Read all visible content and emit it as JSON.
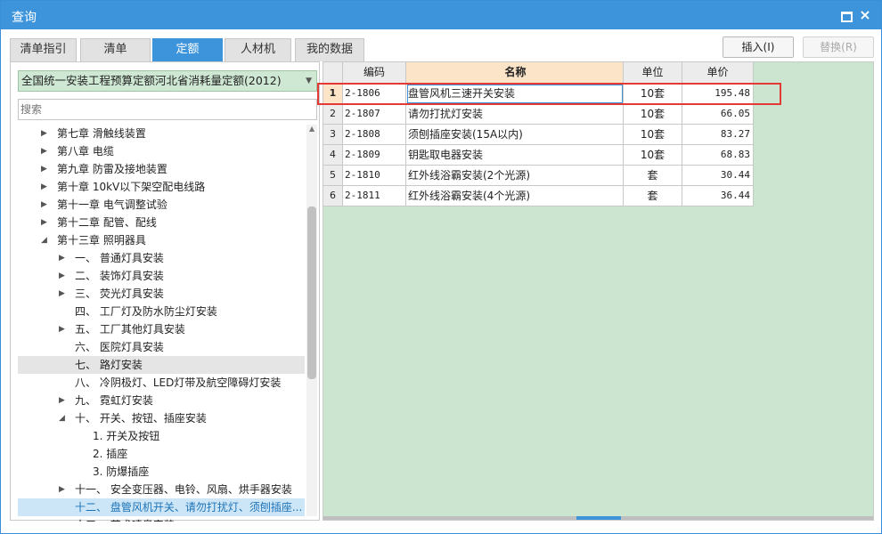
{
  "window": {
    "title": "查询"
  },
  "tabs": [
    "清单指引",
    "清单",
    "定额",
    "人材机",
    "我的数据"
  ],
  "active_tab": "定额",
  "buttons": {
    "insert": "插入(I)",
    "replace": "替换(R)"
  },
  "left": {
    "dropdown_value": "全国统一安装工程预算定额河北省消耗量定额(2012)",
    "search_placeholder": "搜索",
    "tree": [
      {
        "label": "第七章 滑触线装置",
        "level": 0,
        "arrow": "collapsed"
      },
      {
        "label": "第八章 电缆",
        "level": 0,
        "arrow": "collapsed"
      },
      {
        "label": "第九章 防雷及接地装置",
        "level": 0,
        "arrow": "collapsed"
      },
      {
        "label": "第十章 10kV以下架空配电线路",
        "level": 0,
        "arrow": "collapsed"
      },
      {
        "label": "第十一章 电气调整试验",
        "level": 0,
        "arrow": "collapsed"
      },
      {
        "label": "第十二章 配管、配线",
        "level": 0,
        "arrow": "collapsed"
      },
      {
        "label": "第十三章 照明器具",
        "level": 0,
        "arrow": "expanded"
      },
      {
        "label": "一、 普通灯具安装",
        "level": 1,
        "arrow": "collapsed"
      },
      {
        "label": "二、 装饰灯具安装",
        "level": 1,
        "arrow": "collapsed"
      },
      {
        "label": "三、 荧光灯具安装",
        "level": 1,
        "arrow": "collapsed"
      },
      {
        "label": "四、 工厂灯及防水防尘灯安装",
        "level": 1,
        "arrow": "none"
      },
      {
        "label": "五、 工厂其他灯具安装",
        "level": 1,
        "arrow": "collapsed"
      },
      {
        "label": "六、 医院灯具安装",
        "level": 1,
        "arrow": "none"
      },
      {
        "label": "七、 路灯安装",
        "level": 1,
        "arrow": "none",
        "state": "hover"
      },
      {
        "label": "八、 冷阴极灯、LED灯带及航空障碍灯安装",
        "level": 1,
        "arrow": "none"
      },
      {
        "label": "九、 霓虹灯安装",
        "level": 1,
        "arrow": "collapsed"
      },
      {
        "label": "十、 开关、按钮、插座安装",
        "level": 1,
        "arrow": "expanded"
      },
      {
        "label": "1. 开关及按钮",
        "level": 2,
        "arrow": "none"
      },
      {
        "label": "2. 插座",
        "level": 2,
        "arrow": "none"
      },
      {
        "label": "3. 防爆插座",
        "level": 2,
        "arrow": "none"
      },
      {
        "label": "十一、 安全变压器、电铃、风扇、烘手器安装",
        "level": 1,
        "arrow": "collapsed"
      },
      {
        "label": "十二、 盘管风机开关、请勿打扰灯、须刨插座...",
        "level": 1,
        "arrow": "none",
        "state": "selected"
      },
      {
        "label": "十三、 艺术喷泉安装",
        "level": 1,
        "arrow": "collapsed"
      }
    ]
  },
  "table": {
    "columns": [
      "编码",
      "名称",
      "单位",
      "单价"
    ],
    "rows": [
      {
        "no": "1",
        "code": "2-1806",
        "name": "盘管风机三速开关安装",
        "unit": "10套",
        "price": "195.48"
      },
      {
        "no": "2",
        "code": "2-1807",
        "name": "请勿打扰灯安装",
        "unit": "10套",
        "price": "66.05"
      },
      {
        "no": "3",
        "code": "2-1808",
        "name": "须刨插座安装(15A以内)",
        "unit": "10套",
        "price": "83.27"
      },
      {
        "no": "4",
        "code": "2-1809",
        "name": "钥匙取电器安装",
        "unit": "10套",
        "price": "68.83"
      },
      {
        "no": "5",
        "code": "2-1810",
        "name": "红外线浴霸安装(2个光源)",
        "unit": "套",
        "price": "30.44"
      },
      {
        "no": "6",
        "code": "2-1811",
        "name": "红外线浴霸安装(4个光源)",
        "unit": "套",
        "price": "36.44"
      }
    ],
    "selected_row": 1
  },
  "colors": {
    "title_bar": "#3d94db",
    "accent": "#3d94db",
    "grid_background": "#cce5d0",
    "header_highlight": "#fbe4c8",
    "highlight_box": "#e53935",
    "tree_selected": "#cde6f7"
  }
}
